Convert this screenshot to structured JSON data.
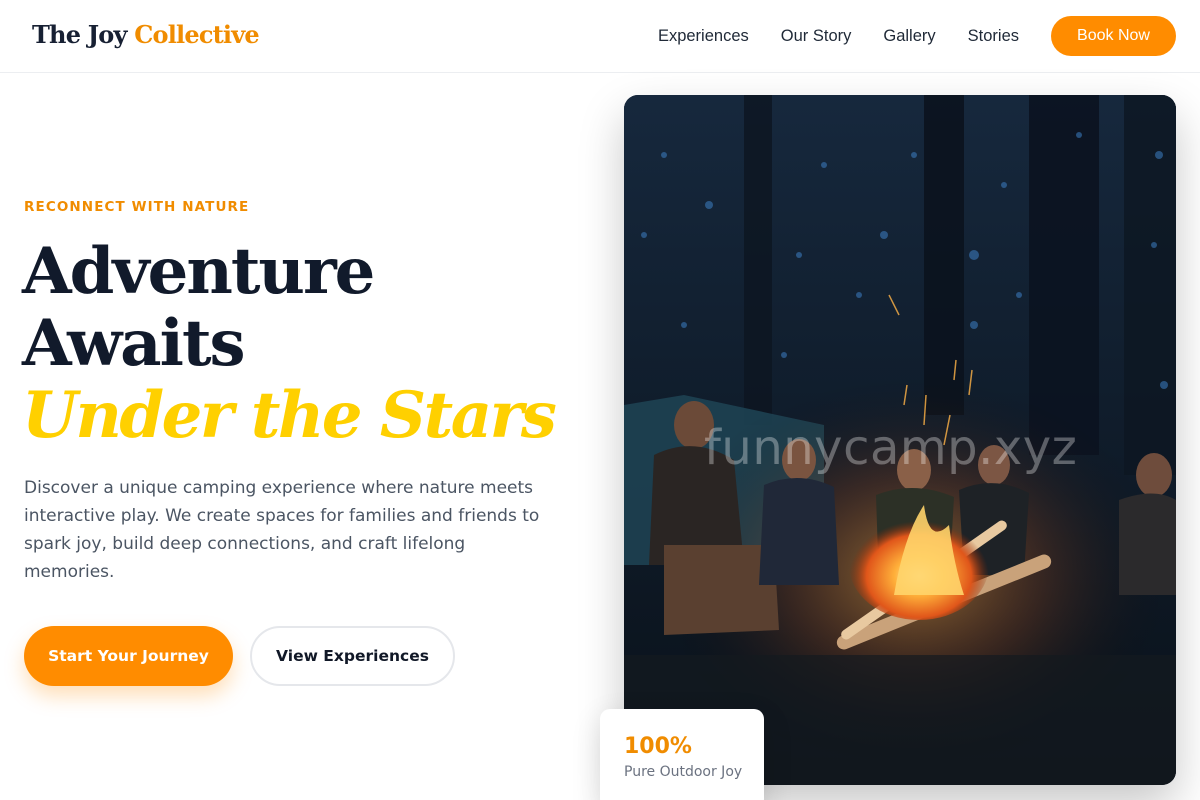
{
  "brand": {
    "name_part1": "The Joy",
    "name_part2": "Collective",
    "accent_color": "#f08c00"
  },
  "nav": {
    "items": [
      {
        "label": "Experiences"
      },
      {
        "label": "Our Story"
      },
      {
        "label": "Gallery"
      },
      {
        "label": "Stories"
      }
    ],
    "cta_label": "Book Now"
  },
  "hero": {
    "eyebrow": "RECONNECT WITH NATURE",
    "headline_line1": "Adventure",
    "headline_line2": "Awaits",
    "headline_line3": "Under the Stars",
    "description": "Discover a unique camping experience where nature meets interactive play. We create spaces for families and friends to spark joy, build deep connections, and craft lifelong memories.",
    "primary_button": "Start Your Journey",
    "secondary_button": "View Experiences",
    "image_watermark": "funnycamp.xyz",
    "image_subject": "campfire-photo"
  },
  "stat": {
    "value": "100%",
    "label": "Pure Outdoor Joy"
  },
  "colors": {
    "primary": "#ff8c00",
    "headline_accent": "#ffd000",
    "dark_text": "#111a2b"
  }
}
